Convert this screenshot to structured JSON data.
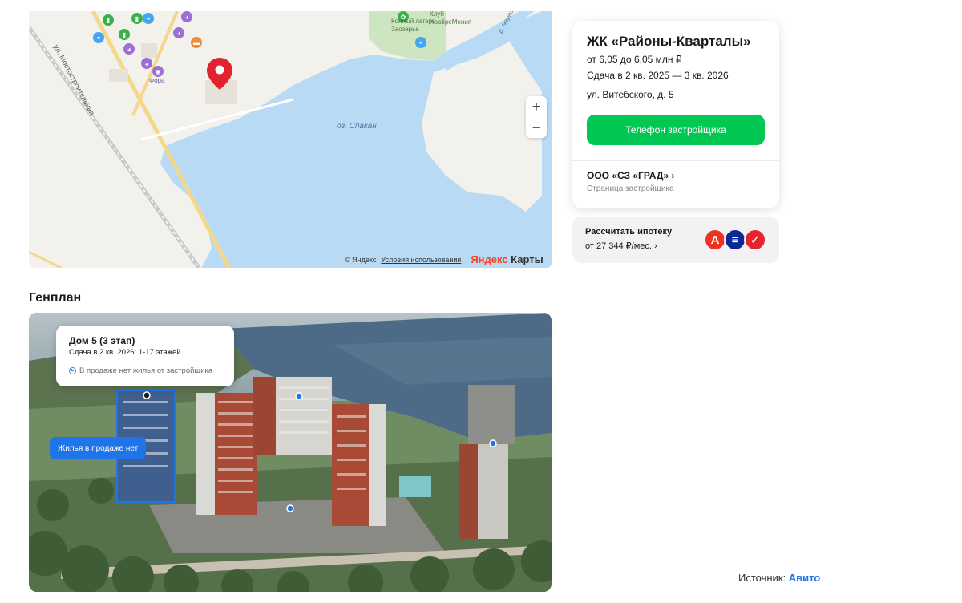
{
  "map": {
    "lake_label": "оз. Спакан",
    "street_label": "ул. Мостостроительная",
    "camp_label_1": "Конный лагерь",
    "camp_label_2": "Заозерье",
    "hr_label_1": "Клуб",
    "hr_label_2": "ХрабреМения",
    "river_label": "р. Черная",
    "fora_label": "Фора",
    "zoom_in": "+",
    "zoom_out": "−",
    "copyright": "© Яндекс",
    "terms": "Условия использования",
    "brand_red": "Яндекс",
    "brand_black": " Карты",
    "colors": {
      "water": "#b9daf4",
      "park": "#cde5c1",
      "road": "#f3d88a",
      "pin": "#e2232f"
    }
  },
  "card": {
    "title": "ЖК «Районы-Кварталы»",
    "price": "от 6,05 до 6,05 млн ₽",
    "deadline": "Сдача в 2 кв. 2025 — 3 кв. 2026",
    "address": "ул. Витебского, д. 5",
    "phone_button": "Телефон застройщика",
    "developer": "ООО «СЗ «ГРАД» ›",
    "developer_sub": "Страница застройщика"
  },
  "mortgage": {
    "title": "Рассчитать ипотеку",
    "sub": "от 27 344 ₽/мес. ›",
    "banks": [
      {
        "icon": "alfa-bank-icon",
        "glyph": "А",
        "color": "#ef3124"
      },
      {
        "icon": "vtb-bank-icon",
        "glyph": "≡",
        "color": "#0a2896"
      },
      {
        "icon": "sovcombank-icon",
        "glyph": "✓",
        "color": "#e4262c"
      }
    ]
  },
  "genplan": {
    "title": "Генплан",
    "tooltip_title": "Дом 5 (3 этап)",
    "tooltip_sub": "Сдача в 2 кв. 2026: 1-17 этажей",
    "tooltip_status": "В продаже нет жилья от застройщика",
    "no_sale_button": "Жилья в продаже нет"
  },
  "source": {
    "label": "Источник: ",
    "link": "Авито"
  }
}
